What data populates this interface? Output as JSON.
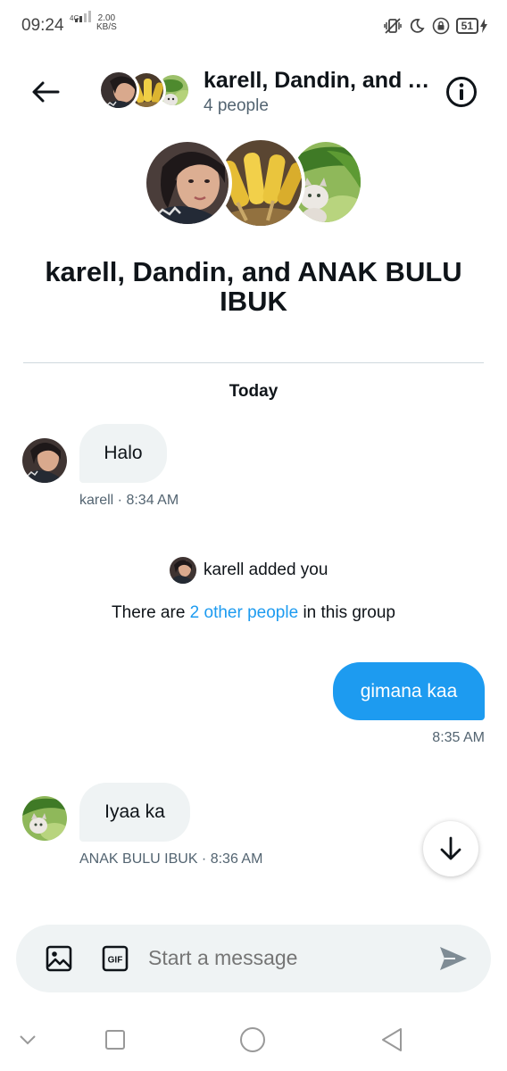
{
  "status_bar": {
    "time": "09:24",
    "network_type": "4G",
    "speed_value": "2.00",
    "speed_unit": "KB/S",
    "battery_level": "51",
    "icons": [
      "vibrate-icon",
      "moon-icon",
      "lock-rotation-icon",
      "battery-icon",
      "charging-icon"
    ]
  },
  "header": {
    "title": "karell, Dandin, and ANAK BULU IBUK",
    "subtitle": "4 people",
    "back_icon": "arrow-left-icon",
    "info_icon": "info-icon"
  },
  "group": {
    "name": "karell, Dandin, and ANAK BULU IBUK"
  },
  "conversation": {
    "day_label": "Today",
    "messages": [
      {
        "direction": "incoming",
        "text": "Halo",
        "meta": "karell · 8:34 AM"
      },
      {
        "direction": "outgoing",
        "text": "gimana kaa",
        "meta": "8:35 AM"
      },
      {
        "direction": "incoming",
        "text": "Iyaa ka",
        "meta": "ANAK BULU IBUK · 8:36 AM"
      }
    ],
    "system_added": "karell added you",
    "system_info": {
      "prefix": "There are ",
      "link": "2 other people",
      "suffix": " in this group"
    }
  },
  "composer": {
    "placeholder": "Start a message",
    "icons": [
      "image-icon",
      "gif-icon",
      "send-icon"
    ]
  },
  "navigation": {
    "icons": [
      "chevron-down-icon",
      "square-icon",
      "circle-icon",
      "triangle-back-icon"
    ]
  },
  "colors": {
    "accent": "#1d9bf0",
    "bubble_incoming": "#eff3f4",
    "text_primary": "#0f1419",
    "text_secondary": "#536471",
    "divider": "#cfd9de"
  }
}
